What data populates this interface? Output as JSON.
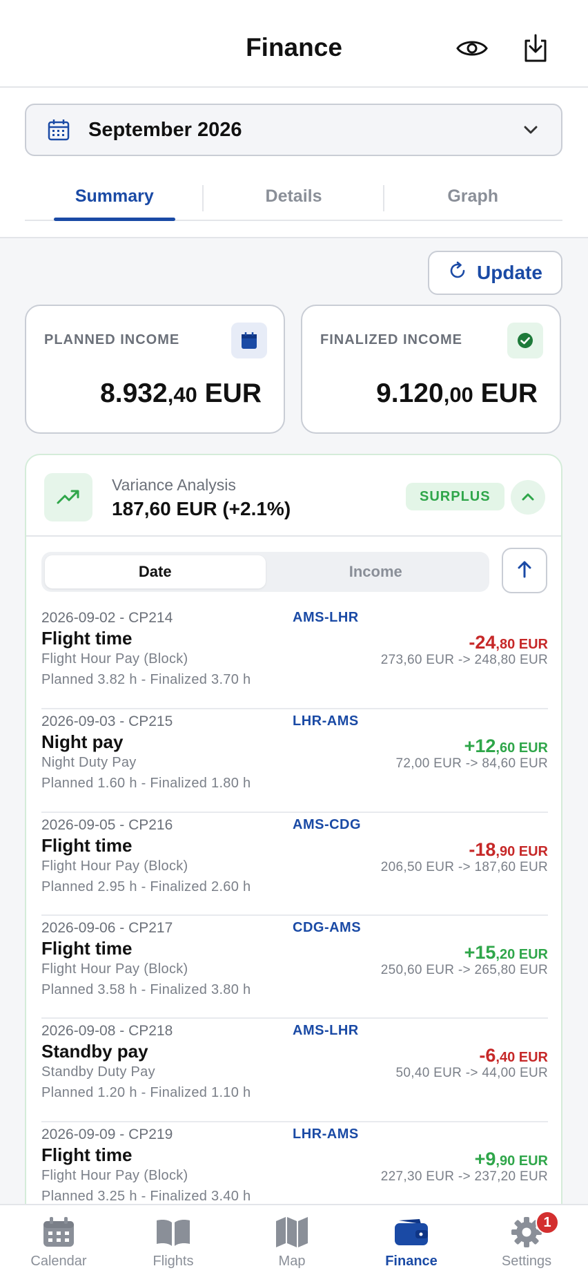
{
  "header": {
    "title": "Finance",
    "visibility_icon": "eye-icon",
    "export_icon": "download-icon"
  },
  "month_selector": {
    "value": "September 2026",
    "icon": "calendar-icon"
  },
  "tabs": [
    {
      "label": "Summary",
      "active": true
    },
    {
      "label": "Details",
      "active": false
    },
    {
      "label": "Graph",
      "active": false
    }
  ],
  "update_button": {
    "label": "Update",
    "icon": "refresh-icon"
  },
  "planned_income": {
    "caption": "PLANNED INCOME",
    "integer": "8.932",
    "decimal": ",40",
    "currency": " EUR",
    "icon": "calendar-icon"
  },
  "finalized_income": {
    "caption": "FINALIZED INCOME",
    "integer": "9.120",
    "decimal": ",00",
    "currency": " EUR",
    "icon": "check-circle-icon"
  },
  "variance": {
    "label": "Variance Analysis",
    "value": "187,60 EUR (+2.1%)",
    "badge": "SURPLUS",
    "icon": "trending-up-icon",
    "toggle_icon": "chevron-up-icon"
  },
  "sort": {
    "options": [
      {
        "label": "Date",
        "active": true
      },
      {
        "label": "Income",
        "active": false
      }
    ],
    "direction_icon": "arrow-up-icon"
  },
  "entries": [
    {
      "meta": "2026-09-02 - CP214",
      "route": "AMS-LHR",
      "title": "Flight time",
      "sub": "Flight Hour Pay (Block)",
      "hours": "Planned 3.82 h - Finalized 3.70 h",
      "delta_int": "-24",
      "delta_dec": ",80 EUR",
      "sign": "neg",
      "change": "273,60 EUR -> 248,80 EUR"
    },
    {
      "meta": "2026-09-03 - CP215",
      "route": "LHR-AMS",
      "title": "Night pay",
      "sub": "Night Duty Pay",
      "hours": "Planned 1.60 h - Finalized 1.80 h",
      "delta_int": "+12",
      "delta_dec": ",60 EUR",
      "sign": "pos",
      "change": "72,00 EUR -> 84,60 EUR"
    },
    {
      "meta": "2026-09-05 - CP216",
      "route": "AMS-CDG",
      "title": "Flight time",
      "sub": "Flight Hour Pay (Block)",
      "hours": "Planned 2.95 h - Finalized 2.60 h",
      "delta_int": "-18",
      "delta_dec": ",90 EUR",
      "sign": "neg",
      "change": "206,50 EUR -> 187,60 EUR"
    },
    {
      "meta": "2026-09-06 - CP217",
      "route": "CDG-AMS",
      "title": "Flight time",
      "sub": "Flight Hour Pay (Block)",
      "hours": "Planned 3.58 h - Finalized 3.80 h",
      "delta_int": "+15",
      "delta_dec": ",20 EUR",
      "sign": "pos",
      "change": "250,60 EUR -> 265,80 EUR"
    },
    {
      "meta": "2026-09-08 - CP218",
      "route": "AMS-LHR",
      "title": "Standby pay",
      "sub": "Standby Duty Pay",
      "hours": "Planned 1.20 h - Finalized 1.10 h",
      "delta_int": "-6",
      "delta_dec": ",40 EUR",
      "sign": "neg",
      "change": "50,40 EUR -> 44,00 EUR"
    },
    {
      "meta": "2026-09-09 - CP219",
      "route": "LHR-AMS",
      "title": "Flight time",
      "sub": "Flight Hour Pay (Block)",
      "hours": "Planned 3.25 h - Finalized 3.40 h",
      "delta_int": "+9",
      "delta_dec": ",90 EUR",
      "sign": "pos",
      "change": "227,30 EUR -> 237,20 EUR"
    }
  ],
  "tabbar": [
    {
      "label": "Calendar",
      "icon": "calendar-icon",
      "active": false
    },
    {
      "label": "Flights",
      "icon": "book-icon",
      "active": false
    },
    {
      "label": "Map",
      "icon": "map-icon",
      "active": false
    },
    {
      "label": "Finance",
      "icon": "wallet-icon",
      "active": true
    },
    {
      "label": "Settings",
      "icon": "gear-icon",
      "active": false,
      "badge": "1"
    }
  ],
  "colors": {
    "accent": "#1a4aa5",
    "positive": "#2fa64a",
    "negative": "#c62828"
  }
}
